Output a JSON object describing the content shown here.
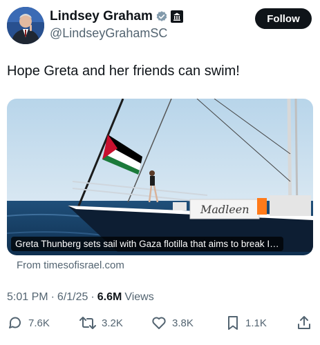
{
  "author": {
    "name": "Lindsey Graham",
    "handle": "@LindseyGrahamSC",
    "verified_icon": "verified-badge-icon",
    "affiliation_icon": "government-building-icon"
  },
  "follow_button": {
    "label": "Follow"
  },
  "tweet": {
    "text": "Hope Greta and her friends can swim!"
  },
  "media_card": {
    "caption": "Greta Thunberg sets sail with Gaza flotilla that aims to break Isr...",
    "boat_name": "Madleen",
    "source": "From timesofisrael.com"
  },
  "meta": {
    "time": "5:01 PM",
    "separator": "·",
    "date": "6/1/25",
    "views_count": "6.6M",
    "views_label": "Views"
  },
  "actions": {
    "replies": "7.6K",
    "reposts": "3.2K",
    "likes": "3.8K",
    "bookmarks": "1.1K"
  },
  "colors": {
    "text_primary": "#0f1419",
    "text_secondary": "#536471",
    "verified": "#829aab",
    "follow_bg": "#0f1419"
  }
}
